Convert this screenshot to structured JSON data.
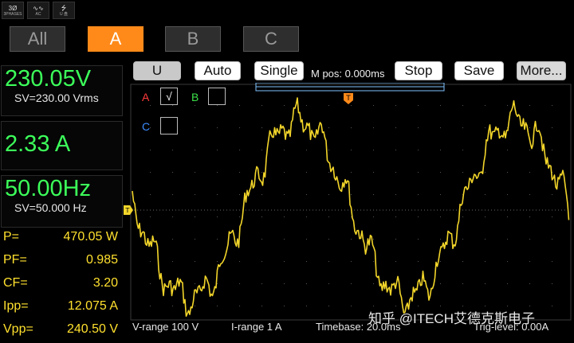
{
  "status_icons": [
    {
      "name": "three-phase-icon",
      "label": "3Ø",
      "sub": "3PHASES"
    },
    {
      "name": "ac-wave-icon",
      "label": "∿∿",
      "sub": "AC"
    },
    {
      "name": "usb-icon",
      "label": "⭍",
      "sub": "U 盘"
    }
  ],
  "phase_tabs": [
    "All",
    "A",
    "B",
    "C"
  ],
  "active_phase": "A",
  "measurements": {
    "voltage": "230.05V",
    "voltage_sv": "SV=230.00 Vrms",
    "current": "2.33 A",
    "frequency": "50.00Hz",
    "frequency_sv": "SV=50.000  Hz"
  },
  "power": [
    {
      "label": "P=",
      "value": "470.05 W"
    },
    {
      "label": "PF=",
      "value": "0.985"
    },
    {
      "label": "CF=",
      "value": "3.20"
    },
    {
      "label": "Ipp=",
      "value": "12.075 A"
    },
    {
      "label": "Vpp=",
      "value": "240.50 V"
    }
  ],
  "toolbar": {
    "u_label": "U",
    "auto_label": "Auto",
    "single_label": "Single",
    "mpos_text": "M pos: 0.000ms",
    "stop_label": "Stop",
    "save_label": "Save",
    "more_label": "More..."
  },
  "channels": {
    "a_label": "A",
    "a_check": "√",
    "b_label": "B",
    "c_label": "C"
  },
  "colors": {
    "channel_a": "#ff3b3b",
    "channel_b": "#3ce04a",
    "channel_c": "#3d8cff",
    "waveform": "#f2d52a",
    "accent": "#ff8a1a",
    "readout_green": "#3cff5a",
    "readout_yellow": "#ffe02e"
  },
  "bottom_info": {
    "vrange": "V-range   100 V",
    "irange": "I-range    1 A",
    "timebase": "Timebase:  20.0ms",
    "trig": "Trig-level:   0.00A"
  },
  "markers": {
    "trigger_position": "T",
    "trigger_level": "T"
  },
  "watermark": "知乎 @ITECH艾德克斯电子"
}
